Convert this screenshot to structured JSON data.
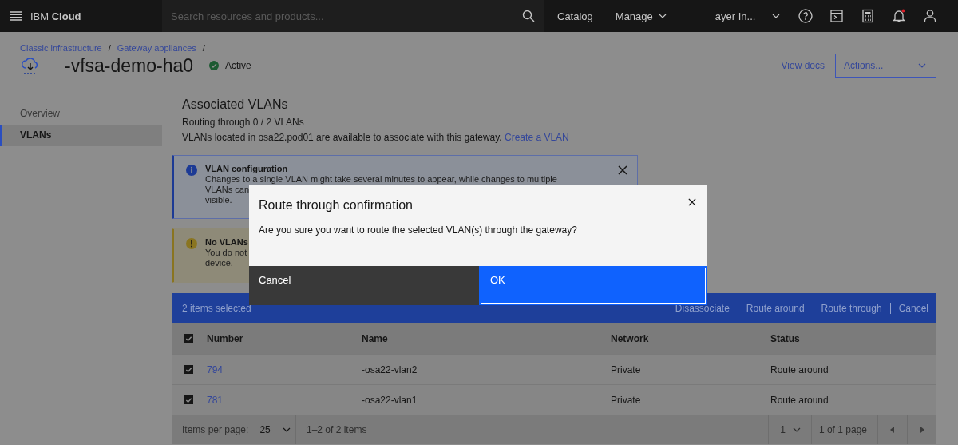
{
  "header": {
    "brand": "IBM **Cloud**",
    "search": {
      "placeholder": "Search resources and products..."
    },
    "nav": [
      {
        "label": "Catalog",
        "kind": "link"
      },
      {
        "label": "Manage",
        "kind": "menu"
      }
    ],
    "account": "ayer In..."
  },
  "breadcrumbs": [
    "Classic infrastructure",
    "Gateway appliances"
  ],
  "breadcrumb_separator": "/",
  "page": {
    "title": "-vfsa-demo-ha0",
    "status": "Active",
    "view_docs": "View docs",
    "actions": "Actions..."
  },
  "sidebar": {
    "items": [
      {
        "label": "Overview",
        "selected": false
      },
      {
        "label": "VLANs",
        "selected": true
      }
    ]
  },
  "section": {
    "title": "Associated VLANs",
    "subtitle": "Routing through 0 / 2 VLANs",
    "description": "VLANs located in osa22.pod01 are available to associate with this gateway.",
    "link": "Create a VLAN"
  },
  "notifications": [
    {
      "kind": "info",
      "title": "VLAN configuration",
      "lines": [
        "Changes to a single VLAN might take several minutes to appear, while changes to multiple",
        "VLANs can",
        "visible."
      ],
      "closable": true
    },
    {
      "kind": "warning",
      "title": "No VLANs",
      "lines": [
        "You do not",
        "device."
      ],
      "closable": false
    }
  ],
  "table": {
    "selection": "2 items selected",
    "batch_actions": [
      "Disassociate",
      "Route around",
      "Route through",
      "Cancel"
    ],
    "select_all_checked": true,
    "columns": [
      "Number",
      "Name",
      "Network",
      "Status"
    ],
    "rows": [
      {
        "checked": true,
        "number": "794",
        "name": "-osa22-vlan2",
        "network": "Private",
        "status": "Route around"
      },
      {
        "checked": true,
        "number": "781",
        "name": "-osa22-vlan1",
        "network": "Private",
        "status": "Route around"
      }
    ],
    "pagination": {
      "label": "Items per page:",
      "page_size": "25",
      "range": "1–2 of 2 items",
      "page": "1",
      "pages": "1 of 1 page"
    }
  },
  "modal": {
    "title": "Route through confirmation",
    "body": "Are you sure you want to route the selected VLAN(s) through the gateway?",
    "secondary": "Cancel",
    "primary": "OK"
  }
}
